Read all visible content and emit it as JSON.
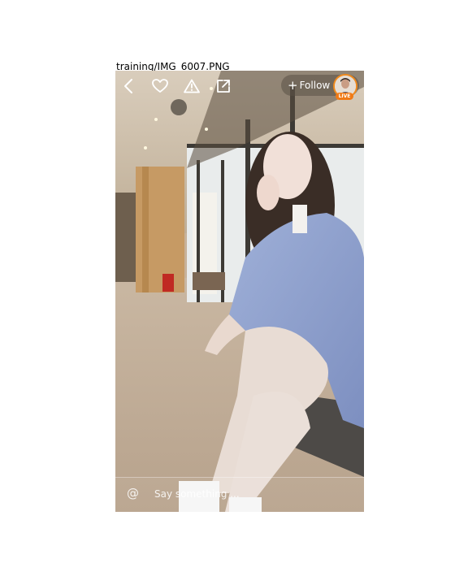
{
  "caption": "training/IMG_6007.PNG",
  "toolbar": {
    "back_icon": "chevron-left-icon",
    "like_icon": "heart-icon",
    "report_icon": "warning-triangle-icon",
    "share_icon": "share-icon",
    "follow_plus": "+",
    "follow_label": "Follow",
    "live_badge": "LIVE"
  },
  "comment": {
    "mention_symbol": "@",
    "placeholder": "Say something ..."
  },
  "colors": {
    "live_orange": "#f07a16",
    "icon_white": "#ffffff"
  }
}
